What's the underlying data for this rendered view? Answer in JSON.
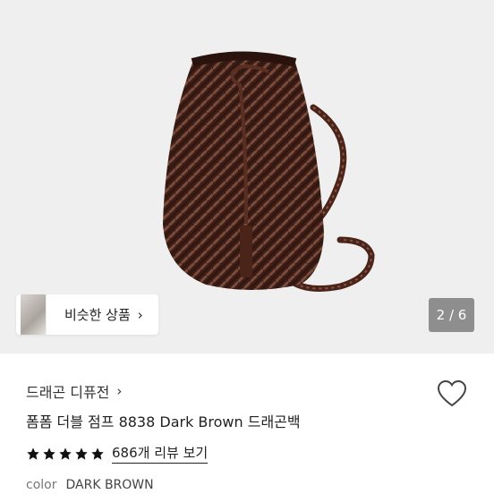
{
  "gallery": {
    "counter": "2 / 6",
    "similar_label": "비슷한 상품"
  },
  "product": {
    "brand": "드래곤 디퓨전",
    "title": "폼폼 더블 점프 8838 Dark Brown 드래곤백",
    "rating_stars": 5,
    "reviews_link": "686개 리뷰 보기",
    "color_label": "color",
    "color_value": "DARK BROWN"
  },
  "colors": {
    "bag": "#3d1f17",
    "gallery_bg": "#efefef",
    "counter_bg": "#8e8e8e"
  },
  "icons": [
    "chevron-right-icon",
    "heart-icon",
    "star-icon"
  ]
}
